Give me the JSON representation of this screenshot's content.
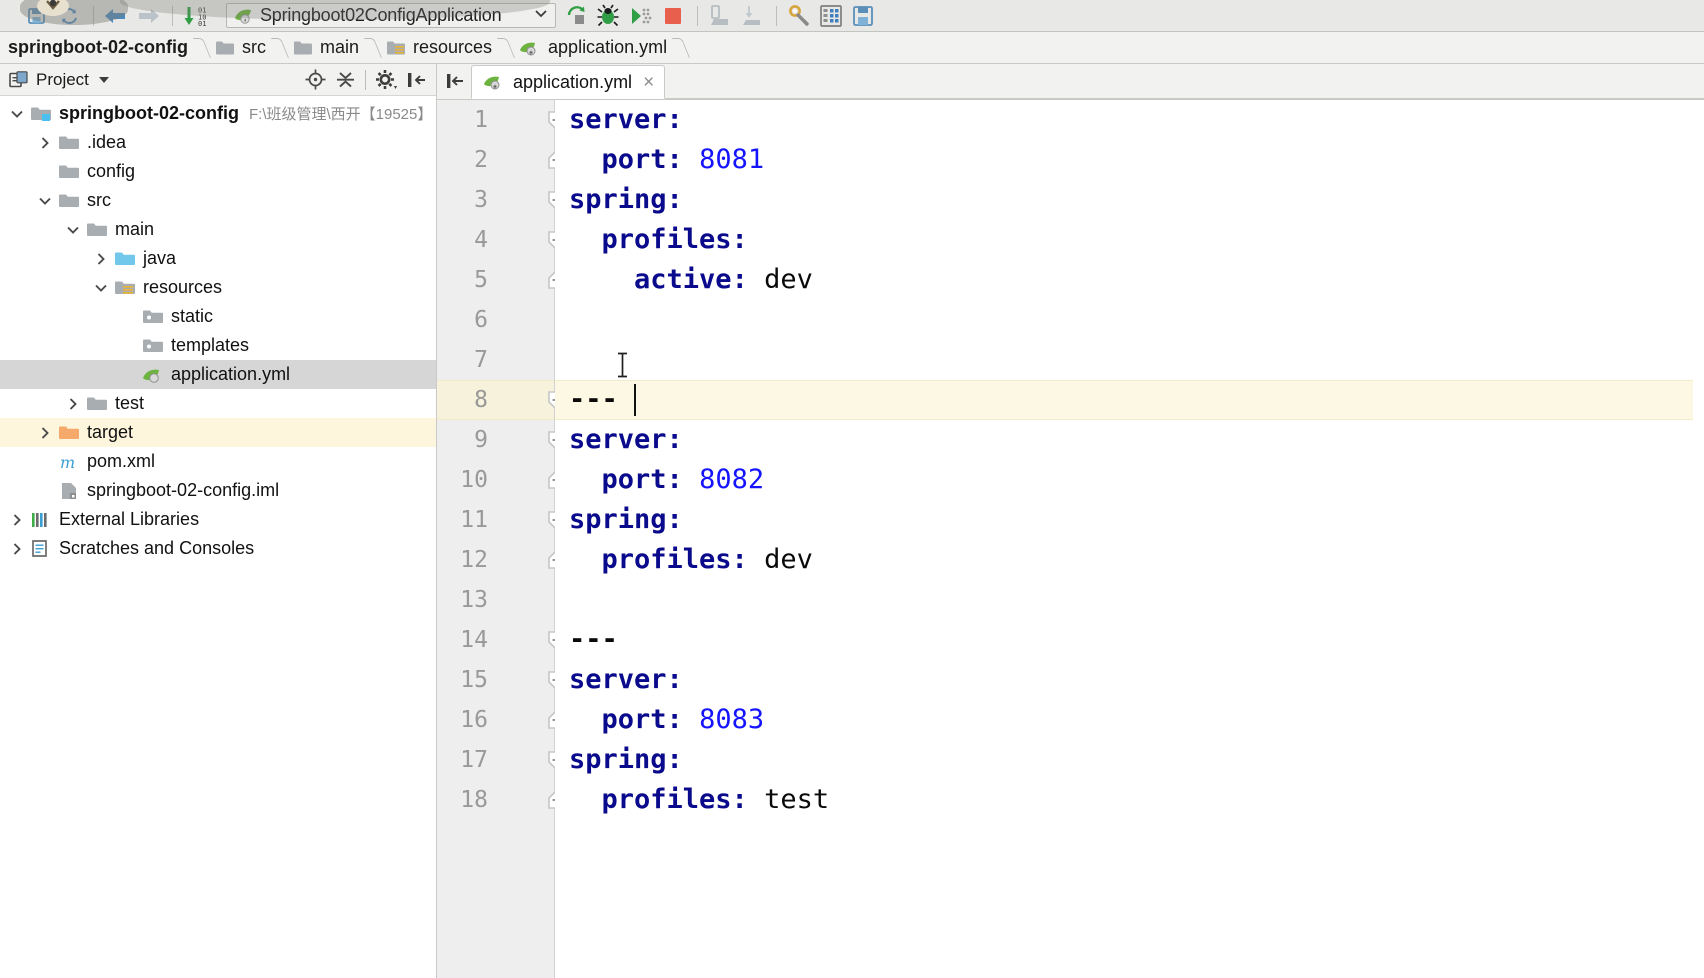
{
  "toolbar": {
    "icons": [
      {
        "name": "save-all-icon",
        "title": "Save All"
      },
      {
        "name": "sync-icon",
        "title": "Synchronize"
      },
      {
        "name": "back-arrow-icon",
        "title": "Back"
      },
      {
        "name": "forward-arrow-icon",
        "title": "Forward"
      },
      {
        "name": "compile-icon",
        "title": "Compile"
      }
    ],
    "run_config": {
      "label": "Springboot02ConfigApplication",
      "icon": "spring-boot-icon",
      "chevron": "chevron-down-icon"
    },
    "actions": [
      {
        "name": "run-icon",
        "title": "Run"
      },
      {
        "name": "debug-icon",
        "title": "Debug"
      },
      {
        "name": "run-coverage-icon",
        "title": "Run with Coverage"
      },
      {
        "name": "stop-icon",
        "title": "Stop"
      },
      {
        "name": "update-app-icon",
        "title": "Update Application"
      },
      {
        "name": "rerun-icon",
        "title": "Rerun"
      },
      {
        "name": "settings-wrench-icon",
        "title": "Settings"
      },
      {
        "name": "project-structure-icon",
        "title": "Project Structure"
      },
      {
        "name": "save-icon",
        "title": "Save"
      }
    ]
  },
  "breadcrumb": {
    "items": [
      {
        "label": "springboot-02-config",
        "icon": "none",
        "root": true
      },
      {
        "label": "src",
        "icon": "folder-icon",
        "root": false
      },
      {
        "label": "main",
        "icon": "folder-icon",
        "root": false
      },
      {
        "label": "resources",
        "icon": "resources-folder-icon",
        "root": false
      },
      {
        "label": "application.yml",
        "icon": "spring-yml-icon",
        "root": false
      }
    ]
  },
  "sidebar": {
    "title": "Project",
    "tools": [
      {
        "name": "scroll-from-source-icon",
        "title": "Select Opened File"
      },
      {
        "name": "collapse-all-icon",
        "title": "Collapse All"
      },
      {
        "name": "gear-icon",
        "title": "Settings"
      },
      {
        "name": "hide-panel-icon",
        "title": "Hide"
      }
    ],
    "tree": [
      {
        "label": "springboot-02-config",
        "path": "F:\\班级管理\\西开【19525】",
        "depth": 0,
        "twist": "expanded",
        "icon": "module-icon",
        "bold": true,
        "state": "none"
      },
      {
        "label": ".idea",
        "path": "",
        "depth": 1,
        "twist": "collapsed",
        "icon": "folder-icon",
        "bold": false,
        "state": "none"
      },
      {
        "label": "config",
        "path": "",
        "depth": 1,
        "twist": "none",
        "icon": "folder-icon",
        "bold": false,
        "state": "none"
      },
      {
        "label": "src",
        "path": "",
        "depth": 1,
        "twist": "expanded",
        "icon": "folder-icon",
        "bold": false,
        "state": "none"
      },
      {
        "label": "main",
        "path": "",
        "depth": 2,
        "twist": "expanded",
        "icon": "folder-icon",
        "bold": false,
        "state": "none"
      },
      {
        "label": "java",
        "path": "",
        "depth": 3,
        "twist": "collapsed",
        "icon": "source-folder-icon",
        "bold": false,
        "state": "none"
      },
      {
        "label": "resources",
        "path": "",
        "depth": 3,
        "twist": "expanded",
        "icon": "resources-folder-icon",
        "bold": false,
        "state": "none"
      },
      {
        "label": "static",
        "path": "",
        "depth": 4,
        "twist": "none",
        "icon": "static-folder-icon",
        "bold": false,
        "state": "none"
      },
      {
        "label": "templates",
        "path": "",
        "depth": 4,
        "twist": "none",
        "icon": "static-folder-icon",
        "bold": false,
        "state": "none"
      },
      {
        "label": "application.yml",
        "path": "",
        "depth": 4,
        "twist": "none",
        "icon": "spring-yml-icon",
        "bold": false,
        "state": "selected"
      },
      {
        "label": "test",
        "path": "",
        "depth": 2,
        "twist": "collapsed",
        "icon": "folder-icon",
        "bold": false,
        "state": "none"
      },
      {
        "label": "target",
        "path": "",
        "depth": 1,
        "twist": "collapsed",
        "icon": "excluded-folder-icon",
        "bold": false,
        "state": "excluded"
      },
      {
        "label": "pom.xml",
        "path": "",
        "depth": 1,
        "twist": "none",
        "icon": "maven-icon",
        "bold": false,
        "state": "none"
      },
      {
        "label": "springboot-02-config.iml",
        "path": "",
        "depth": 1,
        "twist": "none",
        "icon": "iml-icon",
        "bold": false,
        "state": "none"
      },
      {
        "label": "External Libraries",
        "path": "",
        "depth": 0,
        "twist": "collapsed",
        "icon": "libraries-icon",
        "bold": false,
        "state": "none"
      },
      {
        "label": "Scratches and Consoles",
        "path": "",
        "depth": 0,
        "twist": "collapsed",
        "icon": "scratches-icon",
        "bold": false,
        "state": "none"
      }
    ]
  },
  "editor": {
    "tab": {
      "label": "application.yml",
      "icon": "spring-yml-icon",
      "close": "×"
    },
    "current_line": 8,
    "caret": {
      "line": 8,
      "column": 4
    },
    "lines": [
      {
        "num": "1",
        "fold": "start",
        "tokens": [
          {
            "t": "server:",
            "c": "k"
          }
        ]
      },
      {
        "num": "2",
        "fold": "end",
        "tokens": [
          {
            "t": "  ",
            "c": "v"
          },
          {
            "t": "port:",
            "c": "k"
          },
          {
            "t": " ",
            "c": "v"
          },
          {
            "t": "8081",
            "c": "n"
          }
        ]
      },
      {
        "num": "3",
        "fold": "start",
        "tokens": [
          {
            "t": "spring:",
            "c": "k"
          }
        ]
      },
      {
        "num": "4",
        "fold": "start",
        "tokens": [
          {
            "t": "  ",
            "c": "v"
          },
          {
            "t": "profiles:",
            "c": "k"
          }
        ]
      },
      {
        "num": "5",
        "fold": "end",
        "tokens": [
          {
            "t": "    ",
            "c": "v"
          },
          {
            "t": "active:",
            "c": "k"
          },
          {
            "t": " ",
            "c": "v"
          },
          {
            "t": "dev",
            "c": "v"
          }
        ]
      },
      {
        "num": "6",
        "fold": "none",
        "tokens": []
      },
      {
        "num": "7",
        "fold": "none",
        "tokens": []
      },
      {
        "num": "8",
        "fold": "start",
        "tokens": [
          {
            "t": "---",
            "c": "d"
          }
        ]
      },
      {
        "num": "9",
        "fold": "start",
        "tokens": [
          {
            "t": "server:",
            "c": "k"
          }
        ]
      },
      {
        "num": "10",
        "fold": "end",
        "tokens": [
          {
            "t": "  ",
            "c": "v"
          },
          {
            "t": "port:",
            "c": "k"
          },
          {
            "t": " ",
            "c": "v"
          },
          {
            "t": "8082",
            "c": "n"
          }
        ]
      },
      {
        "num": "11",
        "fold": "start",
        "tokens": [
          {
            "t": "spring:",
            "c": "k"
          }
        ]
      },
      {
        "num": "12",
        "fold": "end",
        "tokens": [
          {
            "t": "  ",
            "c": "v"
          },
          {
            "t": "profiles:",
            "c": "k"
          },
          {
            "t": " ",
            "c": "v"
          },
          {
            "t": "dev",
            "c": "v"
          }
        ]
      },
      {
        "num": "13",
        "fold": "none",
        "tokens": []
      },
      {
        "num": "14",
        "fold": "start",
        "tokens": [
          {
            "t": "---",
            "c": "d"
          }
        ]
      },
      {
        "num": "15",
        "fold": "start",
        "tokens": [
          {
            "t": "server:",
            "c": "k"
          }
        ]
      },
      {
        "num": "16",
        "fold": "end",
        "tokens": [
          {
            "t": "  ",
            "c": "v"
          },
          {
            "t": "port:",
            "c": "k"
          },
          {
            "t": " ",
            "c": "v"
          },
          {
            "t": "8083",
            "c": "n"
          }
        ]
      },
      {
        "num": "17",
        "fold": "start",
        "tokens": [
          {
            "t": "spring:",
            "c": "k"
          }
        ]
      },
      {
        "num": "18",
        "fold": "end",
        "tokens": [
          {
            "t": "  ",
            "c": "v"
          },
          {
            "t": "profiles:",
            "c": "k"
          },
          {
            "t": " ",
            "c": "v"
          },
          {
            "t": "test",
            "c": "v"
          }
        ]
      }
    ]
  },
  "colors": {
    "key": "#0a0a8c",
    "number": "#1414ff",
    "value": "#0a0a0a",
    "current_line_bg": "#fcf8e3",
    "selection_bg": "#d6d6d6",
    "excluded_bg": "#fdf6dd",
    "gutter_bg": "#eeeeee",
    "toolbar_bg": "#e8e8e6"
  }
}
